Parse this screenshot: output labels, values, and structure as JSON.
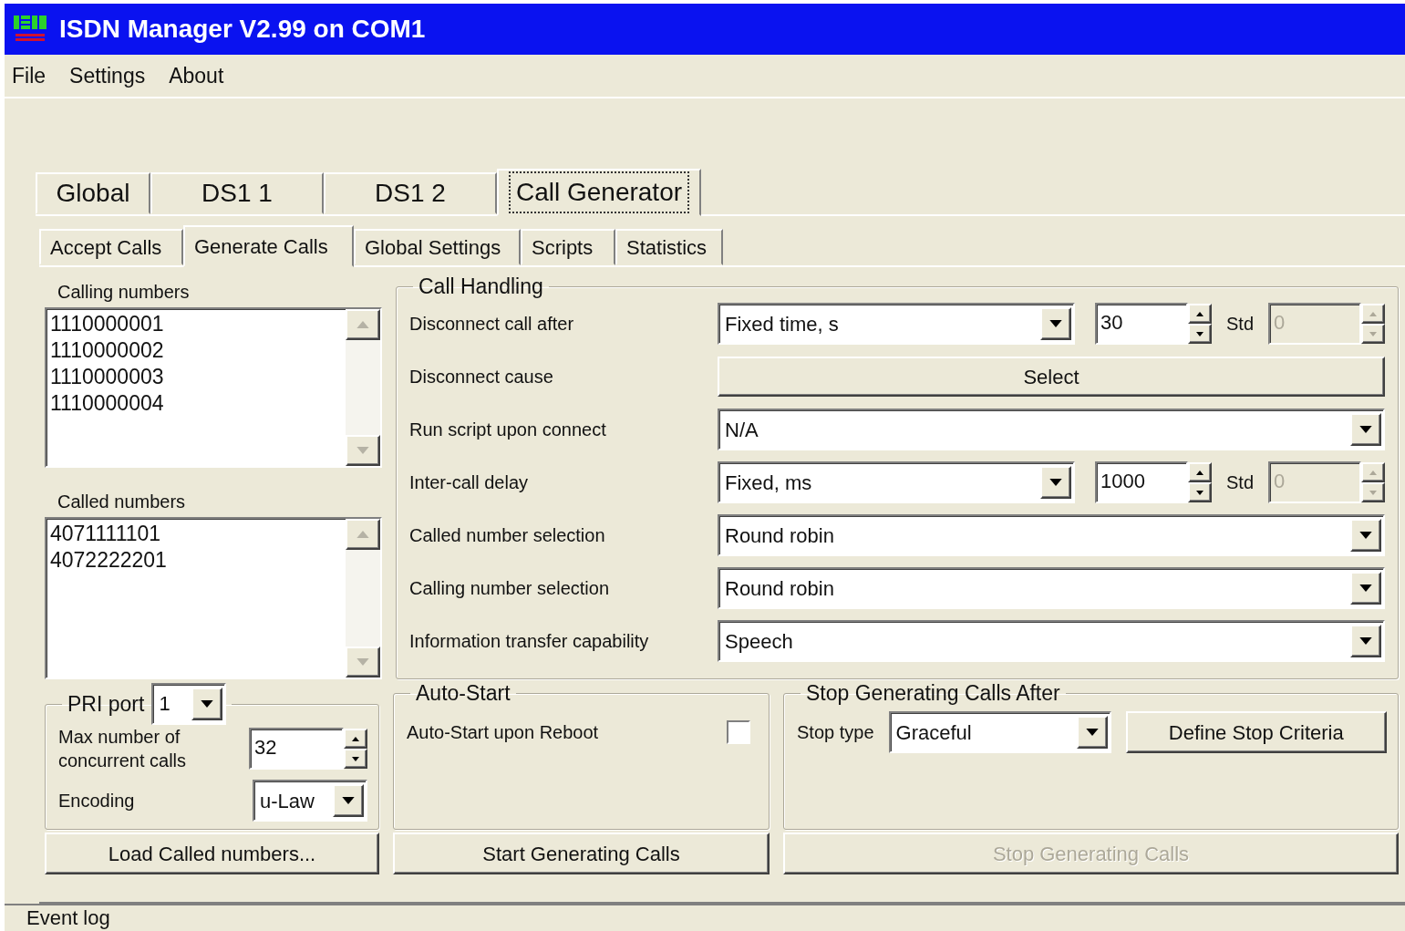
{
  "window": {
    "title": "ISDN Manager V2.99 on COM1"
  },
  "menu": [
    {
      "label": "File"
    },
    {
      "label": "Settings"
    },
    {
      "label": "About"
    }
  ],
  "main_tabs": [
    {
      "label": "Global",
      "selected": false
    },
    {
      "label": "DS1 1",
      "selected": false
    },
    {
      "label": "DS1 2",
      "selected": false
    },
    {
      "label": "Call Generator",
      "selected": true
    }
  ],
  "sub_tabs": [
    {
      "label": "Accept Calls",
      "selected": false
    },
    {
      "label": "Generate Calls",
      "selected": true
    },
    {
      "label": "Global Settings",
      "selected": false
    },
    {
      "label": "Scripts",
      "selected": false
    },
    {
      "label": "Statistics",
      "selected": false
    }
  ],
  "calling_numbers": {
    "label": "Calling numbers",
    "items": [
      "1110000001",
      "1110000002",
      "1110000003",
      "1110000004"
    ]
  },
  "called_numbers": {
    "label": "Called numbers",
    "items": [
      "4071111101",
      "4072222201"
    ]
  },
  "pri_port": {
    "label": "PRI port",
    "value": "1"
  },
  "max_calls": {
    "label": "Max number of concurrent calls",
    "value": "32"
  },
  "encoding": {
    "label": "Encoding",
    "value": "u-Law"
  },
  "call_handling": {
    "title": "Call Handling",
    "rows": [
      {
        "kind": "combo-spin",
        "label": "Disconnect call after",
        "value": "Fixed time, s",
        "spin_value": "30",
        "std_label": "Std",
        "std_value": "0",
        "std_disabled": true
      },
      {
        "kind": "button",
        "label": "Disconnect cause",
        "button": "Select"
      },
      {
        "kind": "combo",
        "label": "Run script upon connect",
        "value": "N/A"
      },
      {
        "kind": "combo-spin",
        "label": "Inter-call delay",
        "value": "Fixed, ms",
        "spin_value": "1000",
        "std_label": "Std",
        "std_value": "0",
        "std_disabled": true
      },
      {
        "kind": "combo",
        "label": "Called number selection",
        "value": "Round robin"
      },
      {
        "kind": "combo",
        "label": "Calling number selection",
        "value": "Round robin"
      },
      {
        "kind": "combo",
        "label": "Information transfer capability",
        "value": "Speech"
      }
    ]
  },
  "auto_start": {
    "title": "Auto-Start",
    "label": "Auto-Start upon Reboot",
    "checked": false
  },
  "stop_after": {
    "title": "Stop Generating Calls After",
    "stop_type_label": "Stop type",
    "stop_type_value": "Graceful",
    "button": "Define Stop Criteria"
  },
  "buttons": [
    {
      "label": "Load Called numbers...",
      "disabled": false
    },
    {
      "label": "Start Generating Calls",
      "disabled": false
    },
    {
      "label": "Stop Generating Calls",
      "disabled": true
    }
  ],
  "status_bar": "Event log"
}
